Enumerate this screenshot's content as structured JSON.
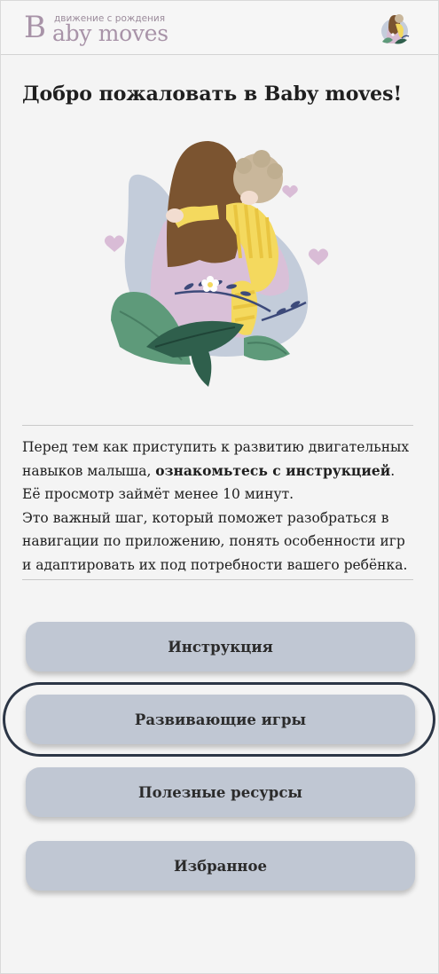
{
  "header": {
    "logo_letter": "B",
    "logo_text": "aby moves",
    "logo_tagline": "движение с рождения",
    "avatar_icon": "mother-child-avatar-icon"
  },
  "welcome_title": "Добро пожаловать в Baby moves!",
  "illustration_icon": "mother-holding-baby-illustration",
  "intro": {
    "line1_prefix": "Перед тем как приступить к развитию двигательных навыков малыша, ",
    "line1_bold": "ознакомьтесь с инструкцией",
    "line1_suffix": ".",
    "line2": "Её просмотр займёт менее 10 минут.",
    "line3": "Это важный шаг, который поможет разобраться в навигации по приложению, понять особенности игр и адаптировать их под потребности вашего ребёнка."
  },
  "menu": {
    "instruction": "Инструкция",
    "games": "Развивающие игры",
    "resources": "Полезные ресурсы",
    "favorites": "Избранное"
  },
  "colors": {
    "accent_logo": "#a893a8",
    "button_bg": "#c0c7d3",
    "focus_ring": "#2c3646",
    "background": "#f4f4f4"
  }
}
